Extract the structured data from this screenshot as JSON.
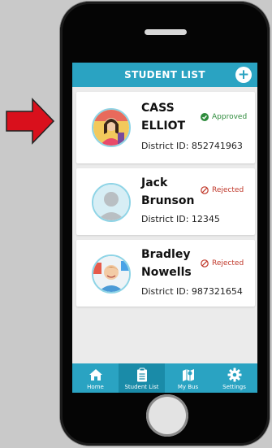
{
  "header": {
    "title": "STUDENT LIST"
  },
  "students": [
    {
      "first_name": "CASS",
      "last_name": "ELLIOT",
      "status": "Approved",
      "district_label": "District ID: 852741963"
    },
    {
      "first_name": "Jack",
      "last_name": "Brunson",
      "status": "Rejected",
      "district_label": "District ID: 12345"
    },
    {
      "first_name": "Bradley",
      "last_name": "Nowells",
      "status": "Rejected",
      "district_label": "District ID: 987321654"
    }
  ],
  "tabs": [
    {
      "label": "Home",
      "icon": "home-icon"
    },
    {
      "label": "Student List",
      "icon": "clipboard-icon"
    },
    {
      "label": "My Bus",
      "icon": "bus-map-icon"
    },
    {
      "label": "Settings",
      "icon": "gear-icon"
    }
  ],
  "colors": {
    "accent": "#2aa3c2",
    "approved": "#2e8b3c",
    "rejected": "#c0392b",
    "arrow": "#d9101c"
  }
}
